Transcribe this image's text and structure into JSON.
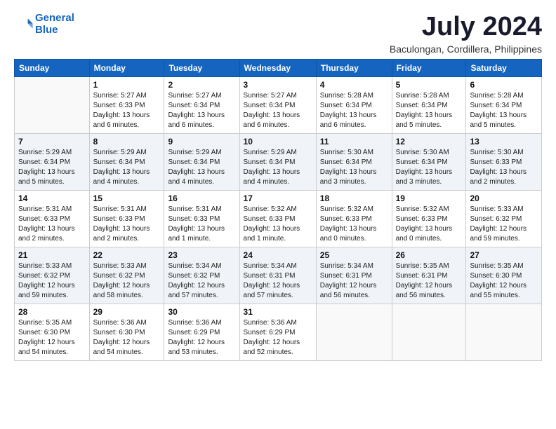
{
  "logo": {
    "line1": "General",
    "line2": "Blue"
  },
  "title": "July 2024",
  "location": "Baculongan, Cordillera, Philippines",
  "days_of_week": [
    "Sunday",
    "Monday",
    "Tuesday",
    "Wednesday",
    "Thursday",
    "Friday",
    "Saturday"
  ],
  "weeks": [
    [
      {
        "day": "",
        "info": ""
      },
      {
        "day": "1",
        "info": "Sunrise: 5:27 AM\nSunset: 6:33 PM\nDaylight: 13 hours\nand 6 minutes."
      },
      {
        "day": "2",
        "info": "Sunrise: 5:27 AM\nSunset: 6:34 PM\nDaylight: 13 hours\nand 6 minutes."
      },
      {
        "day": "3",
        "info": "Sunrise: 5:27 AM\nSunset: 6:34 PM\nDaylight: 13 hours\nand 6 minutes."
      },
      {
        "day": "4",
        "info": "Sunrise: 5:28 AM\nSunset: 6:34 PM\nDaylight: 13 hours\nand 6 minutes."
      },
      {
        "day": "5",
        "info": "Sunrise: 5:28 AM\nSunset: 6:34 PM\nDaylight: 13 hours\nand 5 minutes."
      },
      {
        "day": "6",
        "info": "Sunrise: 5:28 AM\nSunset: 6:34 PM\nDaylight: 13 hours\nand 5 minutes."
      }
    ],
    [
      {
        "day": "7",
        "info": "Sunrise: 5:29 AM\nSunset: 6:34 PM\nDaylight: 13 hours\nand 5 minutes."
      },
      {
        "day": "8",
        "info": "Sunrise: 5:29 AM\nSunset: 6:34 PM\nDaylight: 13 hours\nand 4 minutes."
      },
      {
        "day": "9",
        "info": "Sunrise: 5:29 AM\nSunset: 6:34 PM\nDaylight: 13 hours\nand 4 minutes."
      },
      {
        "day": "10",
        "info": "Sunrise: 5:29 AM\nSunset: 6:34 PM\nDaylight: 13 hours\nand 4 minutes."
      },
      {
        "day": "11",
        "info": "Sunrise: 5:30 AM\nSunset: 6:34 PM\nDaylight: 13 hours\nand 3 minutes."
      },
      {
        "day": "12",
        "info": "Sunrise: 5:30 AM\nSunset: 6:34 PM\nDaylight: 13 hours\nand 3 minutes."
      },
      {
        "day": "13",
        "info": "Sunrise: 5:30 AM\nSunset: 6:33 PM\nDaylight: 13 hours\nand 2 minutes."
      }
    ],
    [
      {
        "day": "14",
        "info": "Sunrise: 5:31 AM\nSunset: 6:33 PM\nDaylight: 13 hours\nand 2 minutes."
      },
      {
        "day": "15",
        "info": "Sunrise: 5:31 AM\nSunset: 6:33 PM\nDaylight: 13 hours\nand 2 minutes."
      },
      {
        "day": "16",
        "info": "Sunrise: 5:31 AM\nSunset: 6:33 PM\nDaylight: 13 hours\nand 1 minute."
      },
      {
        "day": "17",
        "info": "Sunrise: 5:32 AM\nSunset: 6:33 PM\nDaylight: 13 hours\nand 1 minute."
      },
      {
        "day": "18",
        "info": "Sunrise: 5:32 AM\nSunset: 6:33 PM\nDaylight: 13 hours\nand 0 minutes."
      },
      {
        "day": "19",
        "info": "Sunrise: 5:32 AM\nSunset: 6:33 PM\nDaylight: 13 hours\nand 0 minutes."
      },
      {
        "day": "20",
        "info": "Sunrise: 5:33 AM\nSunset: 6:32 PM\nDaylight: 12 hours\nand 59 minutes."
      }
    ],
    [
      {
        "day": "21",
        "info": "Sunrise: 5:33 AM\nSunset: 6:32 PM\nDaylight: 12 hours\nand 59 minutes."
      },
      {
        "day": "22",
        "info": "Sunrise: 5:33 AM\nSunset: 6:32 PM\nDaylight: 12 hours\nand 58 minutes."
      },
      {
        "day": "23",
        "info": "Sunrise: 5:34 AM\nSunset: 6:32 PM\nDaylight: 12 hours\nand 57 minutes."
      },
      {
        "day": "24",
        "info": "Sunrise: 5:34 AM\nSunset: 6:31 PM\nDaylight: 12 hours\nand 57 minutes."
      },
      {
        "day": "25",
        "info": "Sunrise: 5:34 AM\nSunset: 6:31 PM\nDaylight: 12 hours\nand 56 minutes."
      },
      {
        "day": "26",
        "info": "Sunrise: 5:35 AM\nSunset: 6:31 PM\nDaylight: 12 hours\nand 56 minutes."
      },
      {
        "day": "27",
        "info": "Sunrise: 5:35 AM\nSunset: 6:30 PM\nDaylight: 12 hours\nand 55 minutes."
      }
    ],
    [
      {
        "day": "28",
        "info": "Sunrise: 5:35 AM\nSunset: 6:30 PM\nDaylight: 12 hours\nand 54 minutes."
      },
      {
        "day": "29",
        "info": "Sunrise: 5:36 AM\nSunset: 6:30 PM\nDaylight: 12 hours\nand 54 minutes."
      },
      {
        "day": "30",
        "info": "Sunrise: 5:36 AM\nSunset: 6:29 PM\nDaylight: 12 hours\nand 53 minutes."
      },
      {
        "day": "31",
        "info": "Sunrise: 5:36 AM\nSunset: 6:29 PM\nDaylight: 12 hours\nand 52 minutes."
      },
      {
        "day": "",
        "info": ""
      },
      {
        "day": "",
        "info": ""
      },
      {
        "day": "",
        "info": ""
      }
    ]
  ]
}
